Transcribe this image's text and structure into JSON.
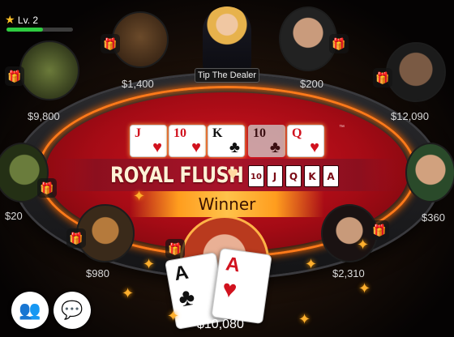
{
  "hud": {
    "level_label": "Lv. 2",
    "star_icon": "★",
    "xp_progress": 0.55
  },
  "dealer": {
    "tip_button_label": "Tip The Dealer"
  },
  "community_cards": [
    {
      "rank": "J",
      "suit": "♥",
      "color": "red"
    },
    {
      "rank": "10",
      "suit": "♥",
      "color": "red"
    },
    {
      "rank": "K",
      "suit": "♣",
      "color": "black"
    },
    {
      "rank": "10",
      "suit": "♣",
      "color": "black",
      "dimmed": true
    },
    {
      "rank": "Q",
      "suit": "♥",
      "color": "red"
    }
  ],
  "result": {
    "hand_name": "ROYAL FLUSH",
    "heart_icon": "♥",
    "hand_cards": [
      "10",
      "J",
      "Q",
      "K",
      "A"
    ],
    "winner_label": "Winner"
  },
  "players": {
    "top_left": {
      "chips": "$1,400"
    },
    "top_right": {
      "chips": "$200"
    },
    "left_upper": {
      "chips": "$9,800"
    },
    "right_upper": {
      "chips": "$12,090"
    },
    "left_mid": {
      "chips": "$20"
    },
    "right_mid": {
      "chips": "$360"
    },
    "bottom_left": {
      "chips": "$980"
    },
    "bottom_right": {
      "chips": "$2,310"
    },
    "hero": {
      "chips": "$10,080"
    }
  },
  "hero_cards": [
    {
      "rank": "A",
      "suit": "♣",
      "color": "black"
    },
    {
      "rank": "A",
      "suit": "♥",
      "color": "red"
    }
  ],
  "icons": {
    "gift": "🎁",
    "friends": "👥",
    "chat": "💬",
    "sparkle": "✦"
  },
  "logo_mark": "™"
}
